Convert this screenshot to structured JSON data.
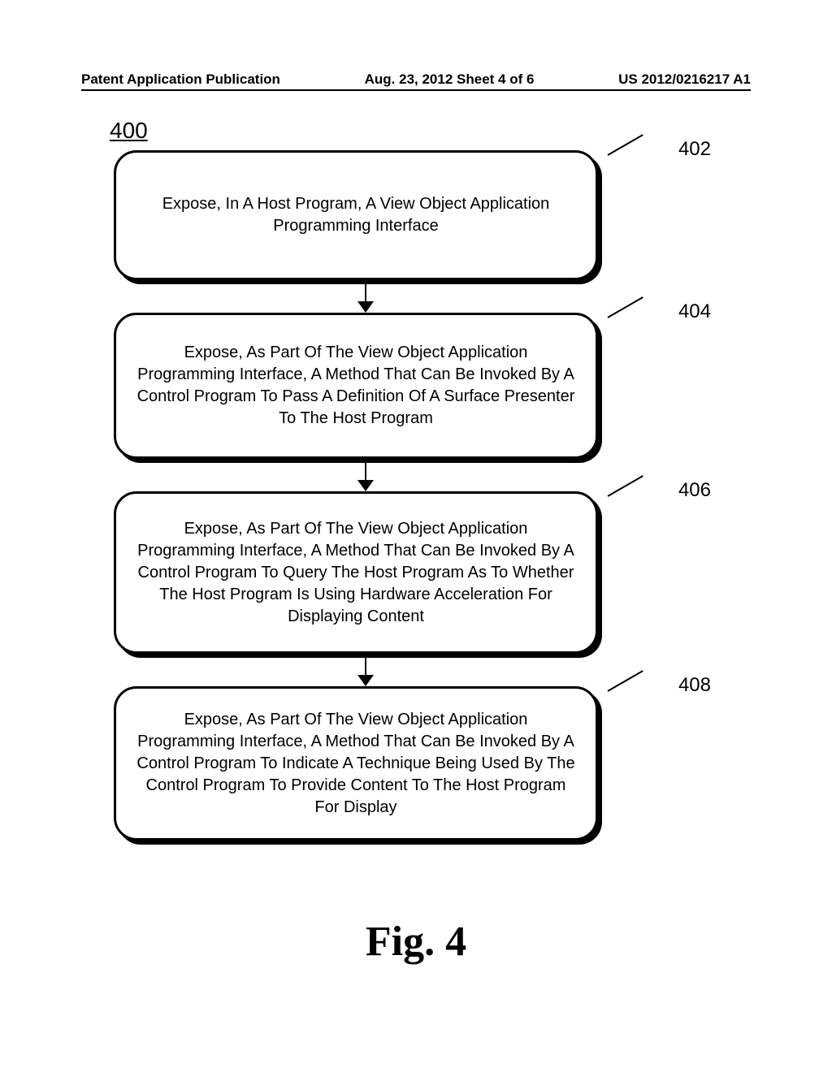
{
  "header": {
    "left": "Patent Application Publication",
    "center": "Aug. 23, 2012  Sheet 4 of 6",
    "right": "US 2012/0216217 A1"
  },
  "figure_number": "400",
  "boxes": {
    "1": {
      "ref": "402",
      "text": "Expose, In A Host Program, A View Object Application Programming Interface"
    },
    "2": {
      "ref": "404",
      "text": "Expose, As Part Of The View Object Application Programming Interface, A Method That Can Be Invoked By A Control Program To Pass A Definition Of A Surface Presenter To The Host Program"
    },
    "3": {
      "ref": "406",
      "text": "Expose, As Part Of The View Object Application Programming Interface, A Method That Can Be Invoked By A Control Program To Query The Host Program As To Whether The Host Program Is Using Hardware Acceleration For Displaying Content"
    },
    "4": {
      "ref": "408",
      "text": "Expose, As Part Of The View Object Application Programming Interface, A Method That Can Be Invoked By A Control Program To Indicate A Technique Being Used By The Control Program To Provide Content To The Host Program For Display"
    }
  },
  "caption": "Fig. 4",
  "chart_data": {
    "type": "flowchart",
    "title": "Fig. 4",
    "figure_ref": "400",
    "nodes": [
      {
        "id": "402",
        "text": "Expose, In A Host Program, A View Object Application Programming Interface"
      },
      {
        "id": "404",
        "text": "Expose, As Part Of The View Object Application Programming Interface, A Method That Can Be Invoked By A Control Program To Pass A Definition Of A Surface Presenter To The Host Program"
      },
      {
        "id": "406",
        "text": "Expose, As Part Of The View Object Application Programming Interface, A Method That Can Be Invoked By A Control Program To Query The Host Program As To Whether The Host Program Is Using Hardware Acceleration For Displaying Content"
      },
      {
        "id": "408",
        "text": "Expose, As Part Of The View Object Application Programming Interface, A Method That Can Be Invoked By A Control Program To Indicate A Technique Being Used By The Control Program To Provide Content To The Host Program For Display"
      }
    ],
    "edges": [
      {
        "from": "402",
        "to": "404"
      },
      {
        "from": "404",
        "to": "406"
      },
      {
        "from": "406",
        "to": "408"
      }
    ]
  }
}
